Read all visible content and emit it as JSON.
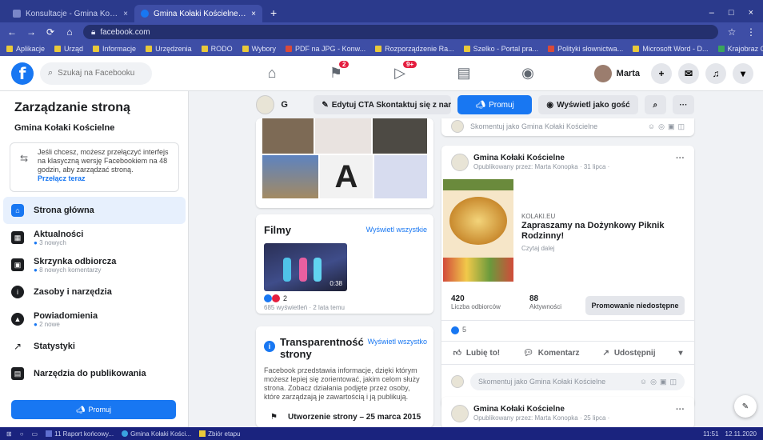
{
  "browser": {
    "tabs": [
      {
        "label": "Konsultacje - Gmina Kołaki Kościelne",
        "active": false
      },
      {
        "label": "Gmina Kołaki Kościelne | Facebook",
        "active": true
      }
    ],
    "url": "facebook.com",
    "bookmarks": [
      "Aplikacje",
      "Urząd",
      "Informacje",
      "Urzędzenia",
      "RODO",
      "Wybory",
      "PDF na JPG - Konw...",
      "Rozporządzenie Ra...",
      "Szelko - Portal pra...",
      "Polityki słownictwa...",
      "Microsoft Word - D...",
      "Krajobraz Obszaró..."
    ]
  },
  "fb": {
    "search_placeholder": "Szukaj na Facebooku",
    "badges": {
      "pages": "2",
      "watch": "9+"
    },
    "profile_name": "Marta"
  },
  "sidebar": {
    "title": "Zarządzanie stroną",
    "page_name": "Gmina Kołaki Kościelne",
    "info_text": "Jeśli chcesz, możesz przełączyć interfejs na klasyczną wersję Facebookiem na 48 godzin, aby zarządzać stroną.",
    "info_link": "Przełącz teraz",
    "items": [
      {
        "label": "Strona główna",
        "meta": "",
        "active": true,
        "icon": "home-icon"
      },
      {
        "label": "Aktualności",
        "meta": "3 nowych",
        "active": false,
        "icon": "news-icon"
      },
      {
        "label": "Skrzynka odbiorcza",
        "meta": "8 nowych komentarzy",
        "active": false,
        "icon": "inbox-icon"
      },
      {
        "label": "Zasoby i narzędzia",
        "meta": "",
        "active": false,
        "icon": "tools-icon"
      },
      {
        "label": "Powiadomienia",
        "meta": "2 nowe",
        "active": false,
        "icon": "bell-icon"
      },
      {
        "label": "Statystyki",
        "meta": "",
        "active": false,
        "icon": "stats-icon"
      },
      {
        "label": "Narzędzia do publikowania",
        "meta": "",
        "active": false,
        "icon": "publish-icon"
      }
    ],
    "promote_label": "Promuj"
  },
  "pagebar": {
    "name": "G",
    "edit_cta": "Edytuj CTA Skontaktuj się z nami",
    "promote": "Promuj",
    "view_as": "Wyświetl jako gość",
    "more": "···"
  },
  "films": {
    "title": "Filmy",
    "see_all": "Wyświetl wszystkie",
    "duration": "0:38",
    "reactions": "2",
    "views": "685 wyświetleń · 2 lata temu"
  },
  "transparency": {
    "title": "Transparentność strony",
    "see_all": "Wyświetl wszystko",
    "body": "Facebook przedstawia informacje, dzięki którym możesz lepiej się zorientować, jakim celom służy strona. Zobacz działania podjęte przez osoby, które zarządzają je zawartością i ją publikują.",
    "event": "Utworzenie strony – 25 marca 2015"
  },
  "feed": {
    "comment_as": "Skomentuj jako Gmina Kołaki Kościelne",
    "post1": {
      "author": "Gmina Kołaki Kościelne",
      "meta": "Opublikowany przez: Marta Konopka · 31 lipca ·",
      "link_domain": "KOLAKI.EU",
      "link_title": "Zapraszamy na Dożynkowy Piknik Rodzinny!",
      "link_sub": "Czytaj dalej",
      "reach_value": "420",
      "reach_label": "Liczba odbiorców",
      "engage_value": "88",
      "engage_label": "Aktywności",
      "boost_label": "Promowanie niedostępne",
      "reactions": "5",
      "like": "Lubię to!",
      "comment": "Komentarz",
      "share": "Udostępnij"
    },
    "post2": {
      "author": "Gmina Kołaki Kościelne",
      "meta": "Opublikowany przez: Marta Konopka · 25 lipca ·"
    }
  },
  "taskbar": {
    "items": [
      "11 Raport końcowy...",
      "Gmina Kołaki Kości...",
      "Zbiór etapu"
    ],
    "time": "11:51",
    "date": "12.11.2020"
  }
}
